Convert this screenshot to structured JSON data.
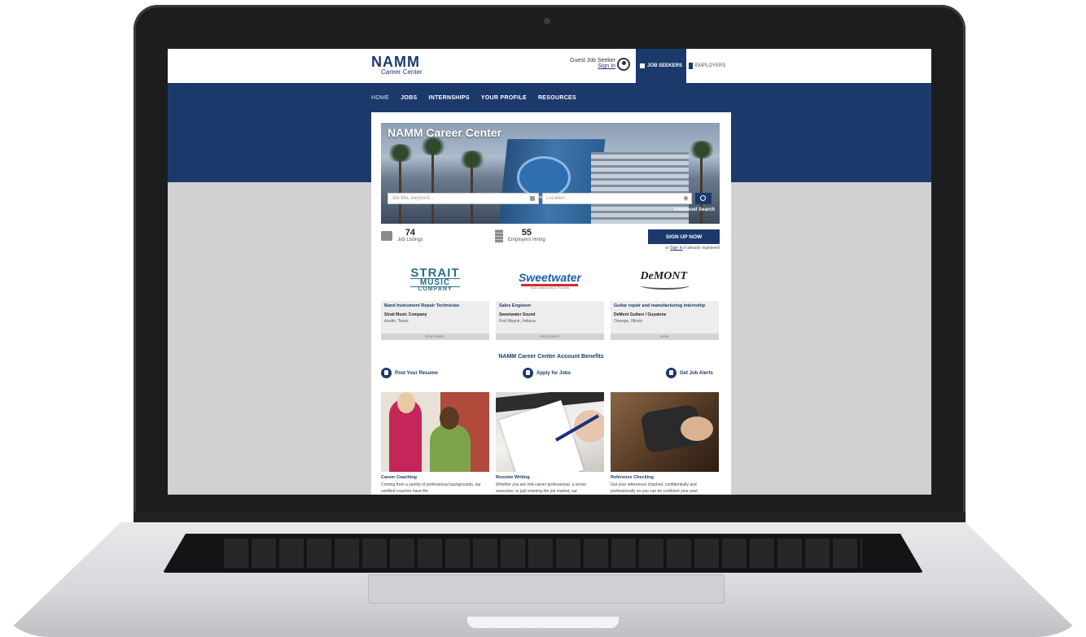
{
  "header": {
    "logo_main": "NAMM",
    "logo_sub": "Career Center",
    "guest_label": "Guest Job Seeker",
    "sign_in": "Sign In",
    "job_seekers_tab": "JOB SEEKERS",
    "employers_tab": "EMPLOYERS"
  },
  "nav": {
    "items": [
      "HOME",
      "JOBS",
      "INTERNSHIPS",
      "YOUR PROFILE",
      "RESOURCES"
    ]
  },
  "hero": {
    "title": "NAMM Career Center",
    "keyword_placeholder": "Job title, keyword...",
    "location_placeholder": "Location",
    "advanced_search": "Advanced Search"
  },
  "stats": {
    "job_count": "74",
    "job_label": "Job Listings",
    "employer_count": "55",
    "employer_label": "Employers Hiring",
    "signup_button": "SIGN UP NOW",
    "already_prefix": "or",
    "already_link": "Sign In",
    "already_suffix": "if already registered"
  },
  "jobs": [
    {
      "logo": [
        "STRAIT",
        "MUSIC",
        "COMPANY"
      ],
      "title": "Band Instrument Repair Technician",
      "company": "Strait Music Company",
      "location": "Austin, Texas",
      "tag": "FEATURED"
    },
    {
      "logo": [
        "Sweetwater",
        "Music Instruments & Pro Audio"
      ],
      "title": "Sales Engineer",
      "company": "Sweetwater Sound",
      "location": "Fort Wayne, Indiana",
      "tag": "FEATURED"
    },
    {
      "logo": [
        "DeMONT"
      ],
      "title": "Guitar repair and manufacturing internship",
      "company": "DeMont Guitars / Guyatone",
      "location": "Oswego, Illinois",
      "tag": "NEW"
    }
  ],
  "benefits": {
    "title": "NAMM Career Center Account Benefits",
    "items": [
      "Post Your Resume",
      "Apply for Jobs",
      "Get Job Alerts"
    ]
  },
  "resources": [
    {
      "title": "Career Coaching",
      "text": "Coming from a variety of professional backgrounds, our certified coaches have the"
    },
    {
      "title": "Resume Writing",
      "text": "Whether you are mid-career professional, a senior executive, or just entering the job market, our"
    },
    {
      "title": "Reference Checking",
      "text": "Get your references checked, confidentially and professionally so you can be confident your past"
    }
  ],
  "colors": {
    "brand_navy": "#1b3a6b",
    "screen_gray": "#d1d1d1",
    "bezel": "#1d1d1f"
  }
}
